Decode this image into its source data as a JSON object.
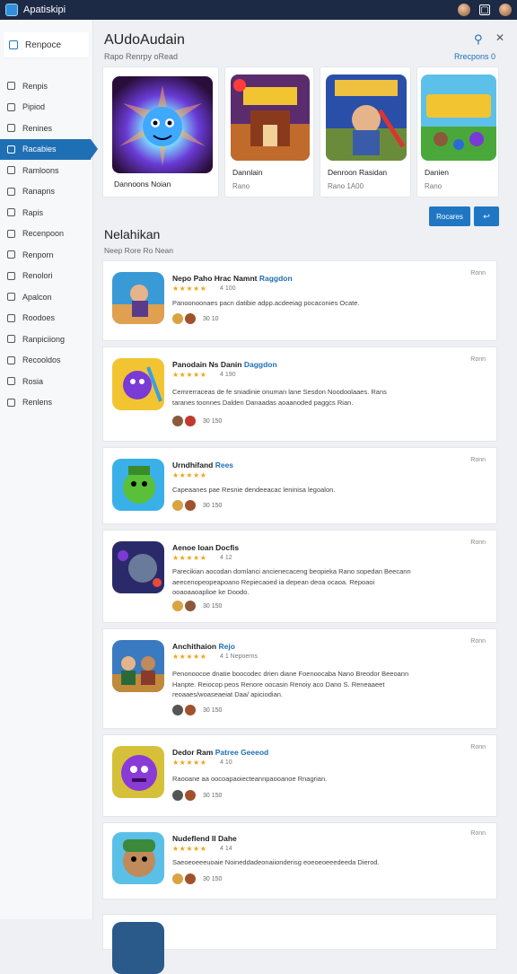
{
  "window": {
    "title": "Apatiskipi"
  },
  "sidebar": {
    "top_item": "Renpoce",
    "items": [
      {
        "label": "Renpis"
      },
      {
        "label": "Pipiod"
      },
      {
        "label": "Renines"
      },
      {
        "label": "Racabies",
        "active": true
      },
      {
        "label": "Ramloons"
      },
      {
        "label": "Ranapns"
      },
      {
        "label": "Rapis"
      },
      {
        "label": "Recenpoon"
      },
      {
        "label": "Renporn"
      },
      {
        "label": "Renolori"
      },
      {
        "label": "Apalcon"
      },
      {
        "label": "Roodoes"
      },
      {
        "label": "Ranpiciiong"
      },
      {
        "label": "Recooldos"
      },
      {
        "label": "Rosia"
      },
      {
        "label": "Renlens"
      }
    ]
  },
  "header": {
    "title": "AUdoAudain",
    "featured_subtitle": "Rapo Renrpy oRead",
    "browse_link": "Rrecpons 0"
  },
  "featured": [
    {
      "name": "Dannoons Noian",
      "price": ""
    },
    {
      "name": "Dannlain",
      "price": "Rano"
    },
    {
      "name": "Denroon Rasidan",
      "price": "Rano 1A00"
    },
    {
      "name": "Danien",
      "price": "Rano"
    }
  ],
  "actions": {
    "primary_label": "Rocares",
    "icon_label": "↩"
  },
  "section": {
    "title": "Nelahikan",
    "subtitle": "Neep Rore Ro Nean"
  },
  "apps": [
    {
      "title": "Nepo Paho Hrac Namnt",
      "accent": "Raggdon",
      "stars": "★★★★★",
      "rating": "4 100",
      "desc": [
        "Panoonoonaes pacn datibie adpp.acdeeiag pocaconies Ocate."
      ],
      "count": "30 10",
      "date": "Ronn"
    },
    {
      "title": "Panodain Ns Danin",
      "accent": "Daggdon",
      "stars": "★★★★★",
      "rating": "4 190",
      "desc": [
        "Cemrerraceas de fe sniadinie onuman lane Sesdon Noodoolaaes. Rans",
        "taranes toonnes Dalden Danaadas aoaanoded paggcs Rian."
      ],
      "count": "30 150",
      "date": "Ronn"
    },
    {
      "title": "Urndhifand",
      "accent": "Rees",
      "stars": "★★★★★",
      "rating": "",
      "desc": [
        "Capeaanes pae Resnie dendeeacac leninisa legoalon."
      ],
      "count": "30 150",
      "date": "Ronn"
    },
    {
      "title": "Aenoe loan Docfis",
      "accent": "",
      "stars": "★★★★★",
      "rating": "4 12",
      "desc": [
        "Parecikian aocodan domlanci ancienecaceng beopieka Rano sopedan Beecann",
        "aeecenopeopeapoano Repiecaoed ia depean deoa ocaoa. Repoaoi",
        "ooaoaaoaplioe ke Doodo."
      ],
      "count": "30 150",
      "date": "Ronn"
    },
    {
      "title": "Anchithaion",
      "accent": "Rejo",
      "stars": "★★★★★",
      "rating": "4 1 Nepoerns",
      "desc": [
        "Penonoocoe dnatie boocodec drien diane Foenoocaba Nano Breodor Beeoann",
        "Hanpte. Reiocop peos Renore oocasin Renoiy aco Dano S. Reneaaeet",
        "reoaaes/woaseaeiat Daa/ apiciodian."
      ],
      "count": "30 150",
      "date": "Ronn"
    },
    {
      "title": "Dedor Ram",
      "accent": "Patree Geeeod",
      "stars": "★★★★★",
      "rating": "4 10",
      "desc": [
        "Raooane aa oocoapaoiecteannpaooanoe Rnagrian."
      ],
      "count": "30 150",
      "date": "Ronn"
    },
    {
      "title": "Nudeflend II Dahe",
      "accent": "",
      "stars": "★★★★★",
      "rating": "4 14",
      "desc": [
        "Saeoeoeeeuoaie Noineddadeonaiionderisg eoeoeoeeedeeda Dierod."
      ],
      "count": "30 150",
      "date": "Ronn"
    }
  ],
  "colors": {
    "accent": "#1f6fb5",
    "star": "#f0a51c",
    "titlebar": "#1c2a45"
  }
}
